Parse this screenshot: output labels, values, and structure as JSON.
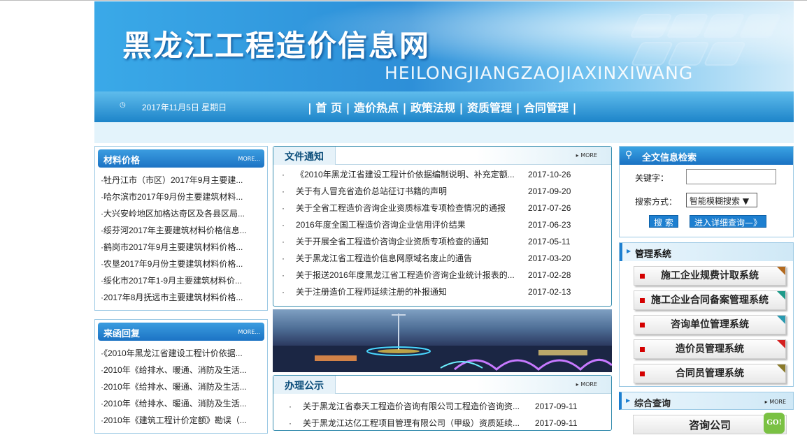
{
  "header": {
    "title": "黑龙江工程造价信息网",
    "subtitle": "HEILONGJIANGZAOJIAXINXIWANG"
  },
  "navbar": {
    "clock_icon": "clock-icon",
    "date": "2017年11月5日 星期日",
    "items": [
      "首 页",
      "造价热点",
      "政策法规",
      "资质管理",
      "合同管理"
    ]
  },
  "left": {
    "materials": {
      "title": "材料价格",
      "more": "MORE...",
      "items": [
        "·牡丹江市（市区）2017年9月主要建...",
        "·哈尔滨市2017年9月份主要建筑材料...",
        "·大兴安岭地区加格达奇区及各县区局...",
        "·绥芬河2017年主要建筑材料价格信息...",
        "·鹤岗市2017年9月主要建筑材料价格...",
        "·农垦2017年9月份主要建筑材料价格...",
        "·绥化市2017年1-9月主要建筑材料价...",
        "·2017年8月抚远市主要建筑材料价格..."
      ]
    },
    "replies": {
      "title": "来函回复",
      "more": "MORE...",
      "items": [
        "·《2010年黑龙江省建设工程计价依据...",
        "·2010年《给排水、暖通、消防及生活...",
        "·2010年《给排水、暖通、消防及生活...",
        "·2010年《给排水、暖通、消防及生活...",
        "·2010年《建筑工程计价定额》勘误（..."
      ]
    }
  },
  "middle": {
    "notices": {
      "title": "文件通知",
      "more": "MORE",
      "rows": [
        {
          "title": "《2010年黑龙江省建设工程计价依据编制说明、补充定额...",
          "date": "2017-10-26"
        },
        {
          "title": "关于有人冒充省造价总站征订书籍的声明",
          "date": "2017-09-20"
        },
        {
          "title": "关于全省工程造价咨询企业资质标准专项检查情况的通报",
          "date": "2017-07-26"
        },
        {
          "title": "2016年度全国工程造价咨询企业信用评价结果",
          "date": "2017-06-23"
        },
        {
          "title": "关于开展全省工程造价咨询企业资质专项检查的通知",
          "date": "2017-05-11"
        },
        {
          "title": "关于黑龙江省工程造价信息网原域名废止的通告",
          "date": "2017-03-20"
        },
        {
          "title": "关于报送2016年度黑龙江省工程造价咨询企业统计报表的...",
          "date": "2017-02-28"
        },
        {
          "title": "关于注册造价工程师延续注册的补报通知",
          "date": "2017-02-13"
        }
      ]
    },
    "public": {
      "title": "办理公示",
      "more": "MORE",
      "rows": [
        {
          "title": "关于黑龙江省泰天工程造价咨询有限公司工程造价咨询资...",
          "date": "2017-09-11"
        },
        {
          "title": "关于黑龙江达亿工程项目管理有限公司（甲级）资质延续...",
          "date": "2017-09-11"
        }
      ]
    }
  },
  "right": {
    "search": {
      "title": "全文信息检索",
      "keyword_label": "关键字：",
      "keyword_value": "",
      "mode_label": "搜索方式：",
      "mode_value": "智能模糊搜索 ▼",
      "search_btn": "搜 索",
      "advanced_btn": "进入详细查询—》"
    },
    "management": {
      "title": "管理系统",
      "systems": [
        "施工企业规费计取系统",
        "施工企业合同备案管理系统",
        "咨询单位管理系统",
        "造价员管理系统",
        "合同员管理系统"
      ]
    },
    "consult": {
      "title": "综合查询",
      "more": "MORE",
      "button": "咨询公司",
      "go": "GO!"
    }
  },
  "colors": {
    "primary": "#1d7fd0",
    "accent_red": "#d40000",
    "title_dark": "#0b4d7a"
  }
}
